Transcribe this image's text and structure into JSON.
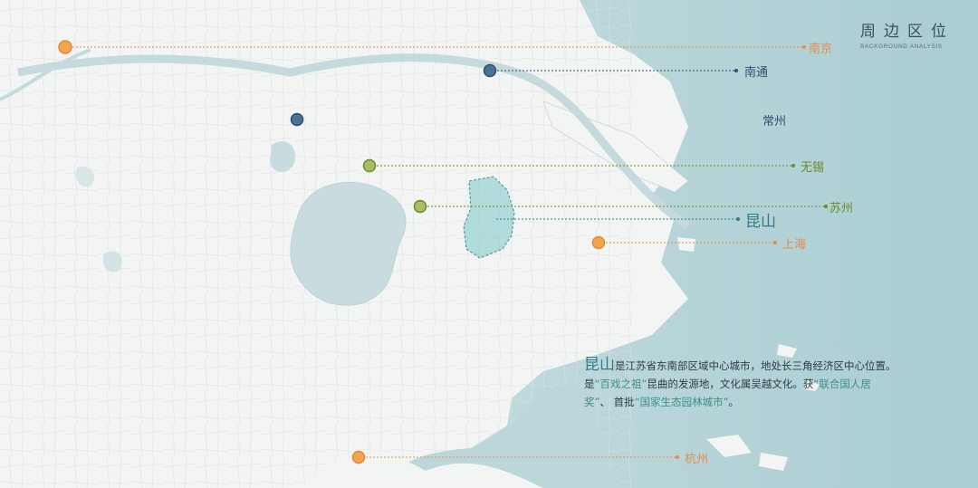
{
  "title": {
    "cn": "周边区位",
    "en": "BACKGROUND ANALYSIS"
  },
  "cities": [
    {
      "name": "南京",
      "color": "#e88b4a"
    },
    {
      "name": "南通",
      "color": "#2d4f6e"
    },
    {
      "name": "常州",
      "color": "#2d4f6e"
    },
    {
      "name": "无锡",
      "color": "#6e8a2e"
    },
    {
      "name": "苏州",
      "color": "#6e8a2e"
    },
    {
      "name": "昆山",
      "color": "#2f7b86"
    },
    {
      "name": "上海",
      "color": "#e88b4a"
    },
    {
      "name": "杭州",
      "color": "#e88b4a"
    }
  ],
  "description": {
    "highlight_name": "昆山",
    "line1_rest": "是江苏省东南部区域中心城市，地处长三角经济区中心位置。",
    "line2_prefix": "是",
    "quote1": "“百戏之祖”",
    "line2_mid": "昆曲的发源地，文化属吴越文化。获",
    "quote2": "“联合国人居",
    "line3_a": "奖”",
    "line3_sep": "、 首批",
    "quote3": "“国家生态园林城市”",
    "line3_end": "。"
  }
}
